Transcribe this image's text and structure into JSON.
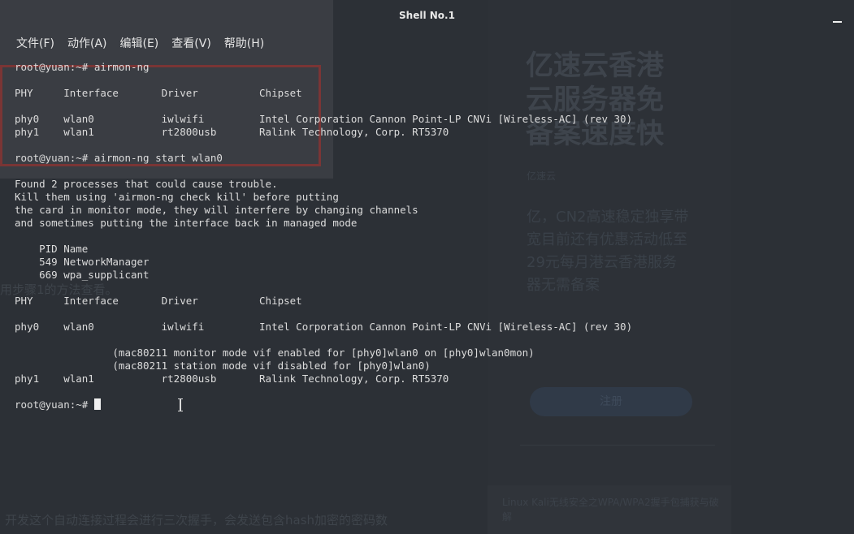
{
  "window": {
    "title": "Shell No.1"
  },
  "menu": [
    "文件(F)",
    "动作(A)",
    "编辑(E)",
    "查看(V)",
    "帮助(H)"
  ],
  "terminal_lines": [
    "root@yuan:~# airmon-ng",
    "",
    "PHY     Interface       Driver          Chipset",
    "",
    "phy0    wlan0           iwlwifi         Intel Corporation Cannon Point-LP CNVi [Wireless-AC] (rev 30)",
    "phy1    wlan1           rt2800usb       Ralink Technology, Corp. RT5370",
    "",
    "root@yuan:~# airmon-ng start wlan0",
    "",
    "Found 2 processes that could cause trouble.",
    "Kill them using 'airmon-ng check kill' before putting",
    "the card in monitor mode, they will interfere by changing channels",
    "and sometimes putting the interface back in managed mode",
    "",
    "    PID Name",
    "    549 NetworkManager",
    "    669 wpa_supplicant",
    "",
    "PHY     Interface       Driver          Chipset",
    "",
    "phy0    wlan0           iwlwifi         Intel Corporation Cannon Point-LP CNVi [Wireless-AC] (rev 30)",
    "",
    "                (mac80211 monitor mode vif enabled for [phy0]wlan0 on [phy0]wlan0mon)",
    "                (mac80211 station mode vif disabled for [phy0]wlan0)",
    "phy1    wlan1           rt2800usb       Ralink Technology, Corp. RT5370",
    ""
  ],
  "prompt": "root@yuan:~# ",
  "background": {
    "ad_title": "亿速云香港云服务器免备案速度快",
    "ad_sub": "亿速云",
    "ad_body": "亿，CN2高速稳定独享带宽目前还有优惠活动低至29元每月港云香港服务器无需备案",
    "ad_button": "注册",
    "ad_card": "Linux Kali无线安全之WPA/WPA2握手包捕获与破解",
    "faint_mid": "用步骤1的方法查看。",
    "faint_bottom": "开发这个自动连接过程会进行三次握手，会发送包含hash加密的密码数"
  },
  "colors": {
    "terminal_bg": "#2a2d33",
    "text": "#dcdcdc",
    "accent_red": "#7a3535"
  }
}
